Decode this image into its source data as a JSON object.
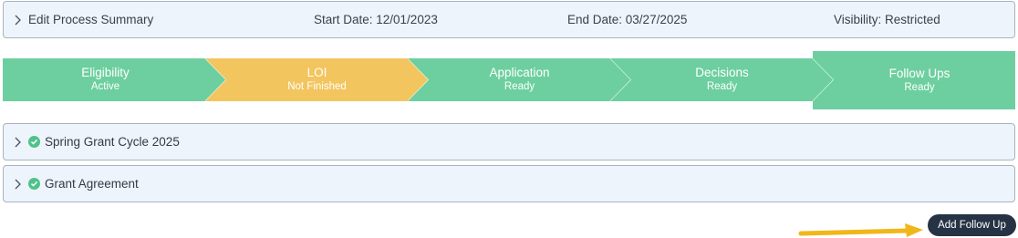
{
  "summary": {
    "toggle_label": "Edit Process Summary",
    "start_date": "Start Date: 12/01/2023",
    "end_date": "End Date: 03/27/2025",
    "visibility": "Visibility: Restricted"
  },
  "stepper": {
    "steps": [
      {
        "title": "Eligibility",
        "status": "Active",
        "color": "#6dcf9f"
      },
      {
        "title": "LOI",
        "status": "Not Finished",
        "color": "#f3c55f"
      },
      {
        "title": "Application",
        "status": "Ready",
        "color": "#6dcf9f"
      },
      {
        "title": "Decisions",
        "status": "Ready",
        "color": "#6dcf9f"
      },
      {
        "title": "Follow Ups",
        "status": "Ready",
        "color": "#6dcf9f"
      }
    ]
  },
  "sections": [
    {
      "label": "Spring Grant Cycle 2025",
      "complete": true
    },
    {
      "label": "Grant Agreement",
      "complete": true
    }
  ],
  "actions": {
    "add_follow_up_label": "Add Follow Up"
  },
  "colors": {
    "step_green": "#6dcf9f",
    "step_yellow": "#f3c55f",
    "panel_bg": "#eef4fb",
    "button_bg": "#263344",
    "arrow": "#f1b619",
    "check": "#4fc28a"
  },
  "icons": {
    "chevron": "chevron-right-icon",
    "check": "check-circle-icon",
    "pointer": "arrow-right-icon"
  }
}
